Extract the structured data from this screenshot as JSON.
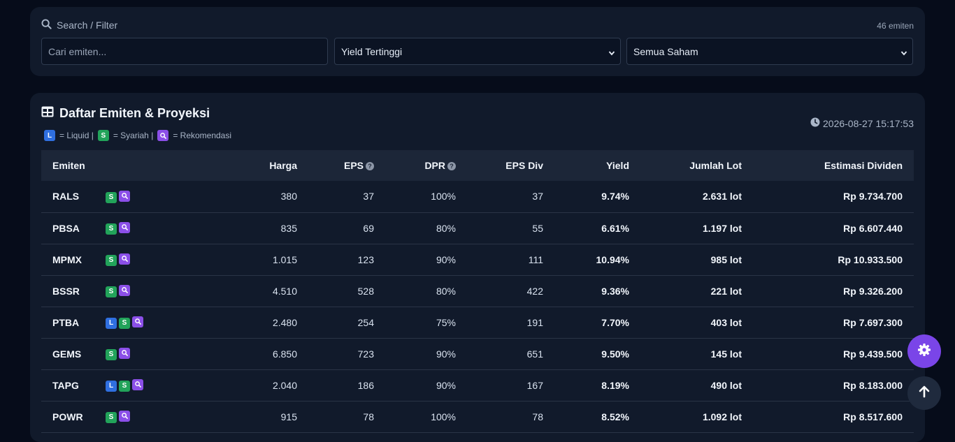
{
  "filter": {
    "heading": "Search / Filter",
    "count": "46 emiten",
    "search_placeholder": "Cari emiten...",
    "sort_selected": "Yield Tertinggi",
    "category_selected": "Semua Saham"
  },
  "table_card": {
    "title": "Daftar Emiten & Proyeksi",
    "legend": [
      {
        "badge": "L",
        "text": "= Liquid |"
      },
      {
        "badge": "S",
        "text": "= Syariah |"
      },
      {
        "badge": "Q",
        "text": "= Rekomendasi"
      }
    ],
    "timestamp": "2026-08-27 15:17:53"
  },
  "columns": [
    "Emiten",
    "Harga",
    "EPS",
    "DPR",
    "EPS Div",
    "Yield",
    "Jumlah Lot",
    "Estimasi Dividen"
  ],
  "badge_labels": {
    "L": "L",
    "S": "S"
  },
  "rows": [
    {
      "emiten": "RALS",
      "badges": [
        "S",
        "Q"
      ],
      "harga": "380",
      "eps": "37",
      "dpr": "100%",
      "eps_div": "37",
      "yield": "9.74%",
      "lot": "2.631 lot",
      "dividen": "Rp 9.734.700"
    },
    {
      "emiten": "PBSA",
      "badges": [
        "S",
        "Q"
      ],
      "harga": "835",
      "eps": "69",
      "dpr": "80%",
      "eps_div": "55",
      "yield": "6.61%",
      "lot": "1.197 lot",
      "dividen": "Rp 6.607.440"
    },
    {
      "emiten": "MPMX",
      "badges": [
        "S",
        "Q"
      ],
      "harga": "1.015",
      "eps": "123",
      "dpr": "90%",
      "eps_div": "111",
      "yield": "10.94%",
      "lot": "985 lot",
      "dividen": "Rp 10.933.500"
    },
    {
      "emiten": "BSSR",
      "badges": [
        "S",
        "Q"
      ],
      "harga": "4.510",
      "eps": "528",
      "dpr": "80%",
      "eps_div": "422",
      "yield": "9.36%",
      "lot": "221 lot",
      "dividen": "Rp 9.326.200"
    },
    {
      "emiten": "PTBA",
      "badges": [
        "L",
        "S",
        "Q"
      ],
      "harga": "2.480",
      "eps": "254",
      "dpr": "75%",
      "eps_div": "191",
      "yield": "7.70%",
      "lot": "403 lot",
      "dividen": "Rp 7.697.300"
    },
    {
      "emiten": "GEMS",
      "badges": [
        "S",
        "Q"
      ],
      "harga": "6.850",
      "eps": "723",
      "dpr": "90%",
      "eps_div": "651",
      "yield": "9.50%",
      "lot": "145 lot",
      "dividen": "Rp 9.439.500"
    },
    {
      "emiten": "TAPG",
      "badges": [
        "L",
        "S",
        "Q"
      ],
      "harga": "2.040",
      "eps": "186",
      "dpr": "90%",
      "eps_div": "167",
      "yield": "8.19%",
      "lot": "490 lot",
      "dividen": "Rp 8.183.000"
    },
    {
      "emiten": "POWR",
      "badges": [
        "S",
        "Q"
      ],
      "harga": "915",
      "eps": "78",
      "dpr": "100%",
      "eps_div": "78",
      "yield": "8.52%",
      "lot": "1.092 lot",
      "dividen": "Rp 8.517.600"
    }
  ]
}
